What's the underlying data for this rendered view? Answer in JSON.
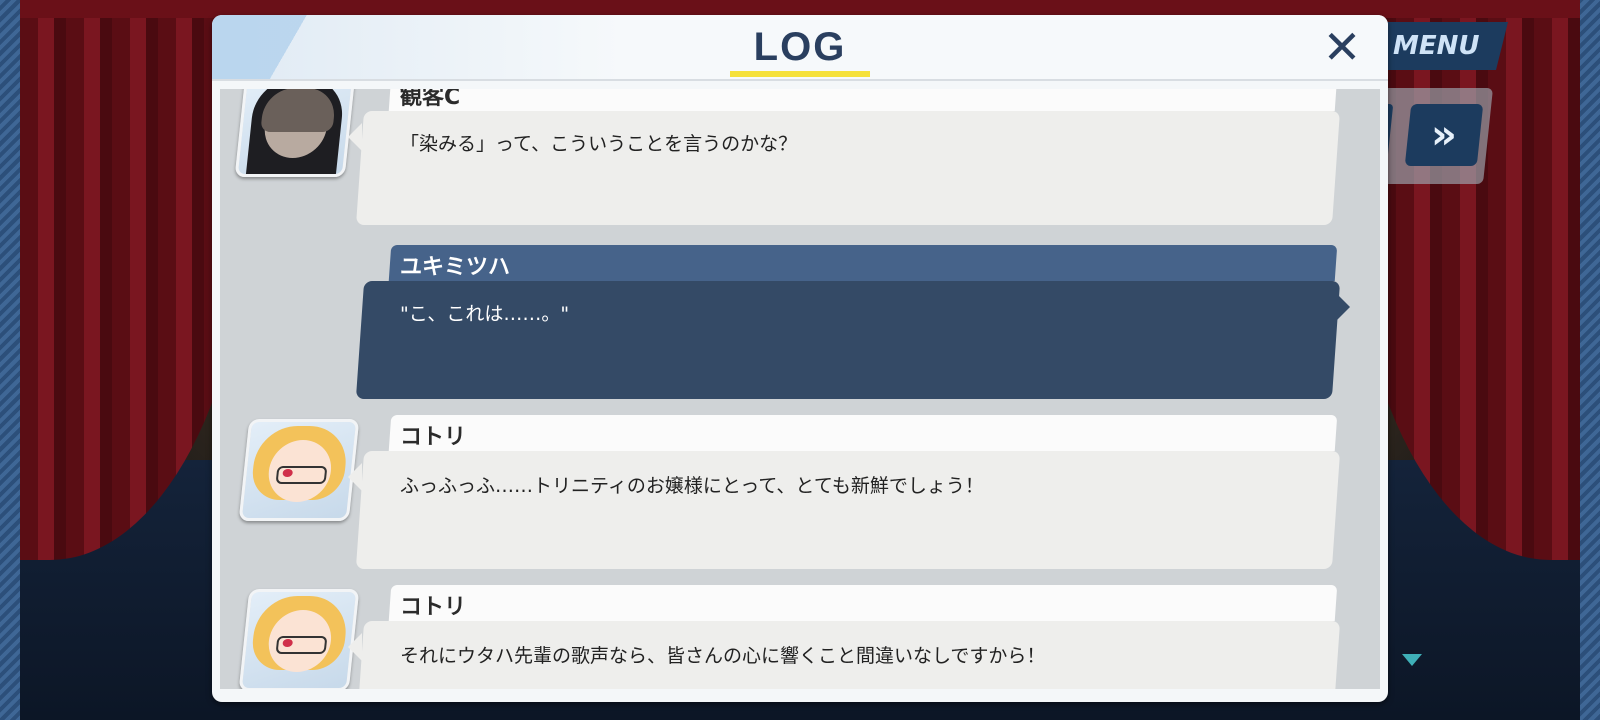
{
  "header": {
    "title": "LOG",
    "close_icon": "close-icon"
  },
  "background": {
    "menu_label": "MENU",
    "skip_icon": "fast-forward-icon"
  },
  "entries": [
    {
      "speaker": "観客C",
      "text": "「染みる」って、こういうことを言うのかな？",
      "type": "npc",
      "portrait": "nun"
    },
    {
      "speaker": "ユキミツハ",
      "text": "\"こ、これは……。\"",
      "type": "player",
      "portrait": ""
    },
    {
      "speaker": "コトリ",
      "text": "ふっふっふ……トリニティのお嬢様にとって、とても新鮮でしょう！",
      "type": "npc",
      "portrait": "kotori"
    },
    {
      "speaker": "コトリ",
      "text": "それにウタハ先輩の歌声なら、皆さんの心に響くこと間違いなしですから！",
      "type": "npc",
      "portrait": "kotori"
    }
  ]
}
